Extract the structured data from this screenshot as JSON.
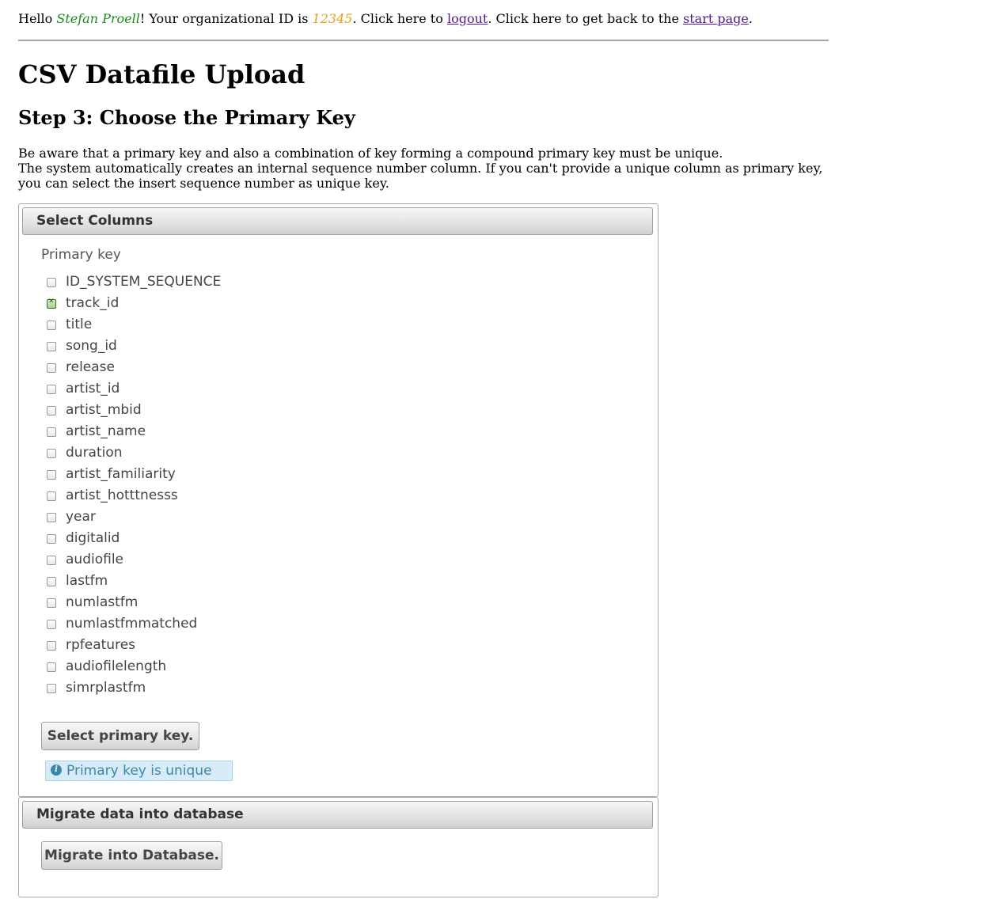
{
  "header": {
    "hello": "Hello ",
    "user_name": "Stefan Proell",
    "org_text": "! Your organizational ID is ",
    "org_id": "12345",
    "logout_prefix": ". Click here to ",
    "logout_link": "logout",
    "start_prefix": ". Click here to get back to the ",
    "start_link": "start page",
    "end": "."
  },
  "page": {
    "title": "CSV Datafile Upload",
    "step_title": "Step 3: Choose the Primary Key",
    "intro_line1": "Be aware that a primary key and also a combination of key forming a compound primary key must be unique.",
    "intro_line2": "The system automatically creates an internal sequence number column. If you can't provide a unique column as primary key,",
    "intro_line3": "you can select the insert sequence number as unique key."
  },
  "select_panel": {
    "header": "Select Columns",
    "field_label": "Primary key",
    "columns": [
      {
        "name": "ID_SYSTEM_SEQUENCE",
        "checked": false
      },
      {
        "name": "track_id",
        "checked": true
      },
      {
        "name": "title",
        "checked": false
      },
      {
        "name": "song_id",
        "checked": false
      },
      {
        "name": "release",
        "checked": false
      },
      {
        "name": "artist_id",
        "checked": false
      },
      {
        "name": "artist_mbid",
        "checked": false
      },
      {
        "name": "artist_name",
        "checked": false
      },
      {
        "name": "duration",
        "checked": false
      },
      {
        "name": "artist_familiarity",
        "checked": false
      },
      {
        "name": "artist_hotttnesss",
        "checked": false
      },
      {
        "name": "year",
        "checked": false
      },
      {
        "name": "digitalid",
        "checked": false
      },
      {
        "name": "audiofile",
        "checked": false
      },
      {
        "name": "lastfm",
        "checked": false
      },
      {
        "name": "numlastfm",
        "checked": false
      },
      {
        "name": "numlastfmmatched",
        "checked": false
      },
      {
        "name": "rpfeatures",
        "checked": false
      },
      {
        "name": "audiofilelength",
        "checked": false
      },
      {
        "name": "simrplastfm",
        "checked": false
      }
    ],
    "button_label": "Select primary key.",
    "info_message": "Primary key is unique",
    "info_icon": "info-icon"
  },
  "migrate_panel": {
    "header": "Migrate data into database",
    "button_label": "Migrate into Database."
  },
  "colors": {
    "user_name": "#1a8a1a",
    "org_id": "#e6a019",
    "link": "#551a8b",
    "info_text": "#3a87ad",
    "info_bg": "#d7ecf7"
  }
}
